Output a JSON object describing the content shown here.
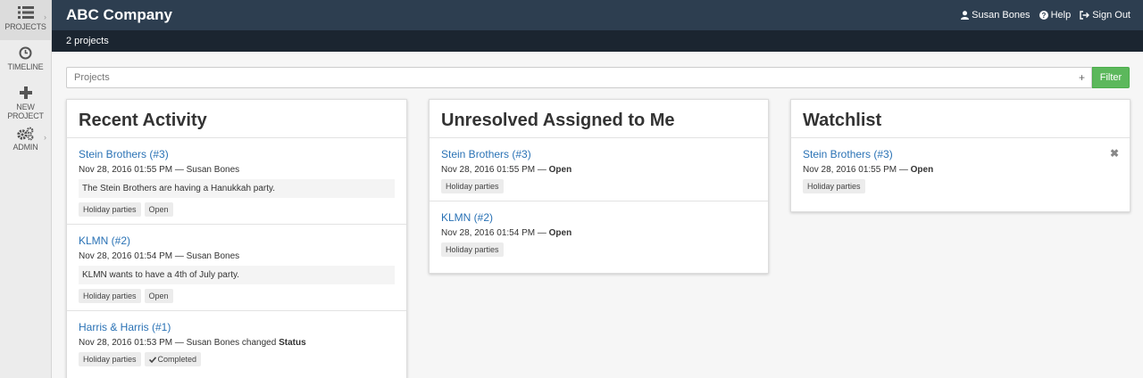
{
  "sidebar": {
    "items": [
      {
        "label": "PROJECTS",
        "icon": "list-icon"
      },
      {
        "label": "TIMELINE",
        "icon": "clock-icon"
      },
      {
        "label": "NEW PROJECT",
        "icon": "plus-icon"
      },
      {
        "label": "ADMIN",
        "icon": "gears-icon"
      }
    ]
  },
  "header": {
    "brand": "ABC Company",
    "user": "Susan Bones",
    "help": "Help",
    "signout": "Sign Out",
    "bg_color": "#2d3e50"
  },
  "subheader": {
    "text": "2 projects"
  },
  "filter": {
    "placeholder": "Projects",
    "add_symbol": "+",
    "button": "Filter",
    "button_color": "#5cb85c"
  },
  "recent": {
    "title": "Recent Activity",
    "entries": [
      {
        "link": "Stein Brothers (#3)",
        "date": "Nov 28, 2016 01:55 PM",
        "sep": "—",
        "user": "Susan Bones",
        "desc": "The Stein Brothers are having a Hanukkah party.",
        "tags": [
          "Holiday parties",
          "Open"
        ]
      },
      {
        "link": "KLMN (#2)",
        "date": "Nov 28, 2016 01:54 PM",
        "sep": "—",
        "user": "Susan Bones",
        "desc": "KLMN wants to have a 4th of July party.",
        "tags": [
          "Holiday parties",
          "Open"
        ]
      },
      {
        "link": "Harris & Harris (#1)",
        "date": "Nov 28, 2016 01:53 PM",
        "sep": "—",
        "user": "Susan Bones changed",
        "field": "Status",
        "tags": [
          "Holiday parties",
          "Completed"
        ]
      }
    ]
  },
  "unresolved": {
    "title": "Unresolved Assigned to Me",
    "entries": [
      {
        "link": "Stein Brothers (#3)",
        "date": "Nov 28, 2016 01:55 PM",
        "sep": "—",
        "status": "Open",
        "tag": "Holiday parties"
      },
      {
        "link": "KLMN (#2)",
        "date": "Nov 28, 2016 01:54 PM",
        "sep": "—",
        "status": "Open",
        "tag": "Holiday parties"
      }
    ]
  },
  "watchlist": {
    "title": "Watchlist",
    "entries": [
      {
        "link": "Stein Brothers (#3)",
        "date": "Nov 28, 2016 01:55 PM",
        "sep": "—",
        "status": "Open",
        "tag": "Holiday parties",
        "remove": "✖"
      }
    ]
  },
  "colors": {
    "link": "#2a72b5",
    "subbar": "#1b2530"
  }
}
